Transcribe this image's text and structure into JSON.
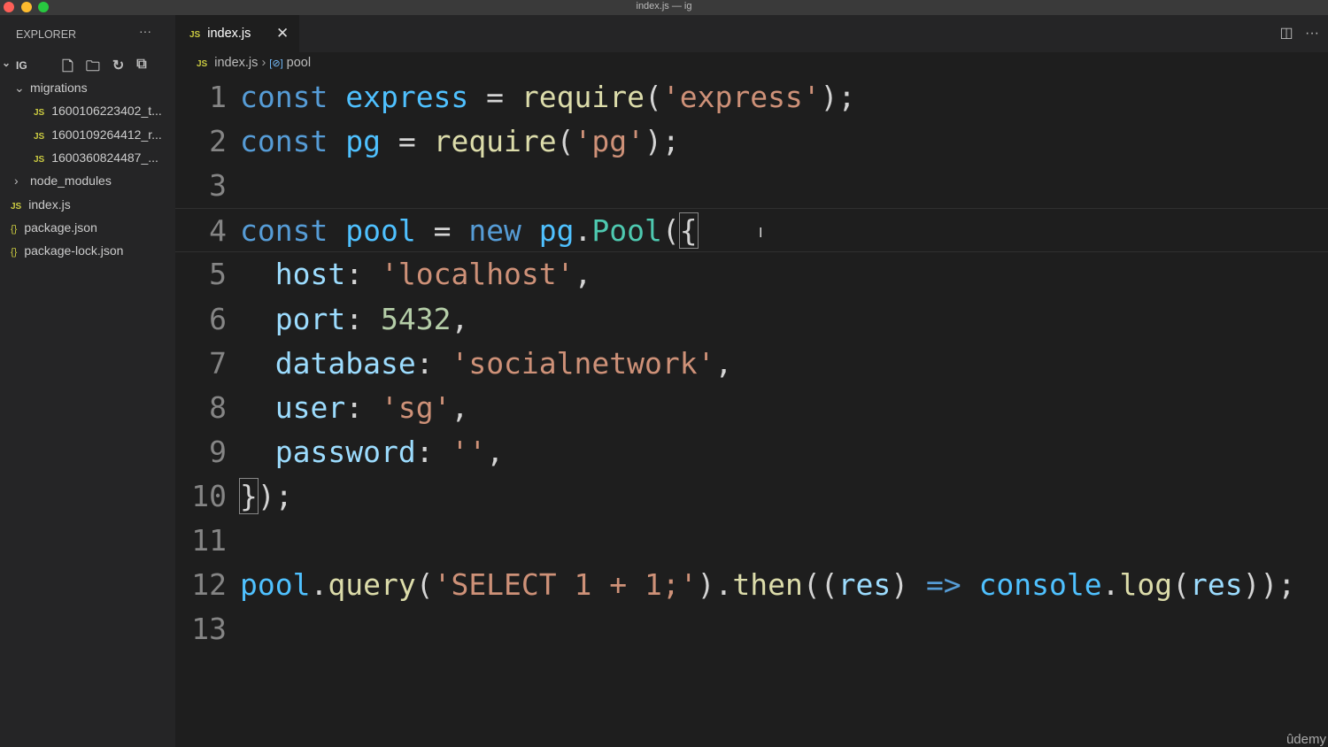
{
  "window": {
    "title": "index.js — ig"
  },
  "sidebar": {
    "header": "EXPLORER",
    "more": "···",
    "root": "IG",
    "items": [
      {
        "label": "migrations",
        "type": "folder-open",
        "depth": 1
      },
      {
        "label": "1600106223402_t...",
        "type": "js",
        "depth": 2
      },
      {
        "label": "1600109264412_r...",
        "type": "js",
        "depth": 2
      },
      {
        "label": "1600360824487_...",
        "type": "js",
        "depth": 2
      },
      {
        "label": "node_modules",
        "type": "folder-closed",
        "depth": 1
      },
      {
        "label": "index.js",
        "type": "js",
        "depth": 1
      },
      {
        "label": "package.json",
        "type": "json",
        "depth": 1
      },
      {
        "label": "package-lock.json",
        "type": "json",
        "depth": 1
      }
    ]
  },
  "tab": {
    "label": "index.js",
    "icon": "JS"
  },
  "breadcrumb": {
    "file": "index.js",
    "symbol": "pool"
  },
  "editor": {
    "lines": [
      [
        [
          "kw",
          "const "
        ],
        [
          "var",
          "express"
        ],
        [
          "pun",
          " = "
        ],
        [
          "fn",
          "require"
        ],
        [
          "pun",
          "("
        ],
        [
          "str",
          "'express'"
        ],
        [
          "pun",
          ");"
        ]
      ],
      [
        [
          "kw",
          "const "
        ],
        [
          "var",
          "pg"
        ],
        [
          "pun",
          " = "
        ],
        [
          "fn",
          "require"
        ],
        [
          "pun",
          "("
        ],
        [
          "str",
          "'pg'"
        ],
        [
          "pun",
          ");"
        ]
      ],
      [],
      [
        [
          "kw",
          "const "
        ],
        [
          "var",
          "pool"
        ],
        [
          "pun",
          " = "
        ],
        [
          "kw",
          "new "
        ],
        [
          "var",
          "pg"
        ],
        [
          "pun",
          "."
        ],
        [
          "cls",
          "Pool"
        ],
        [
          "pun",
          "("
        ],
        [
          "bm",
          "{"
        ]
      ],
      [
        [
          "pun",
          "  "
        ],
        [
          "prop",
          "host"
        ],
        [
          "pun",
          ": "
        ],
        [
          "str",
          "'localhost'"
        ],
        [
          "pun",
          ","
        ]
      ],
      [
        [
          "pun",
          "  "
        ],
        [
          "prop",
          "port"
        ],
        [
          "pun",
          ": "
        ],
        [
          "num",
          "5432"
        ],
        [
          "pun",
          ","
        ]
      ],
      [
        [
          "pun",
          "  "
        ],
        [
          "prop",
          "database"
        ],
        [
          "pun",
          ": "
        ],
        [
          "str",
          "'socialnetwork'"
        ],
        [
          "pun",
          ","
        ]
      ],
      [
        [
          "pun",
          "  "
        ],
        [
          "prop",
          "user"
        ],
        [
          "pun",
          ": "
        ],
        [
          "str",
          "'sg'"
        ],
        [
          "pun",
          ","
        ]
      ],
      [
        [
          "pun",
          "  "
        ],
        [
          "prop",
          "password"
        ],
        [
          "pun",
          ": "
        ],
        [
          "str",
          "''"
        ],
        [
          "pun",
          ","
        ]
      ],
      [
        [
          "bm",
          "}"
        ],
        [
          "pun",
          ");"
        ]
      ],
      [],
      [
        [
          "var",
          "pool"
        ],
        [
          "pun",
          "."
        ],
        [
          "fn",
          "query"
        ],
        [
          "pun",
          "("
        ],
        [
          "str",
          "'SELECT 1 + 1;'"
        ],
        [
          "pun",
          ")."
        ],
        [
          "fn",
          "then"
        ],
        [
          "pun",
          "(("
        ],
        [
          "prop",
          "res"
        ],
        [
          "pun",
          ") "
        ],
        [
          "kw",
          "=>"
        ],
        [
          "pun",
          " "
        ],
        [
          "var",
          "console"
        ],
        [
          "pun",
          "."
        ],
        [
          "fn",
          "log"
        ],
        [
          "pun",
          "("
        ],
        [
          "prop",
          "res"
        ],
        [
          "pun",
          "));"
        ]
      ],
      []
    ]
  },
  "watermark": "ûdemy"
}
